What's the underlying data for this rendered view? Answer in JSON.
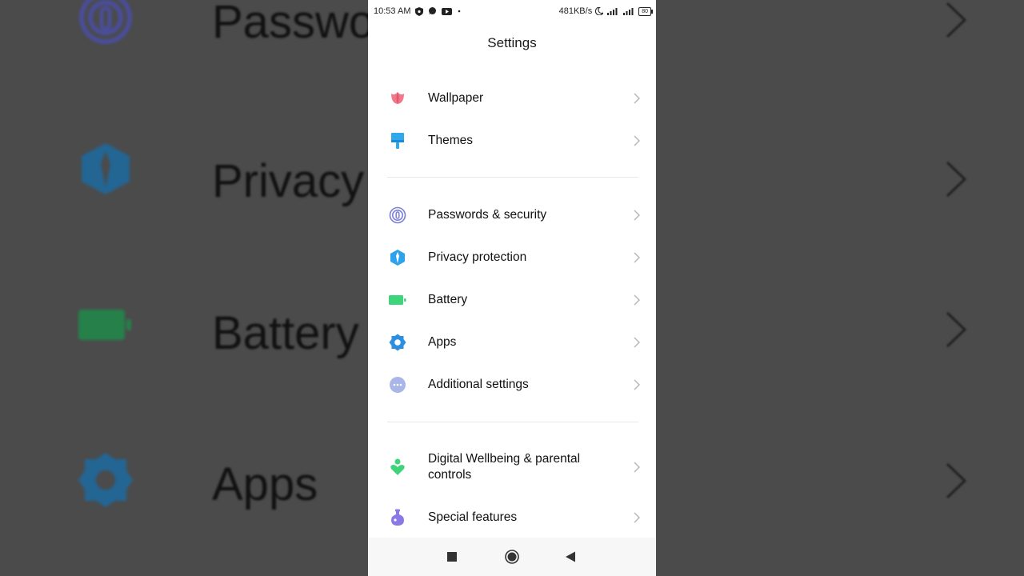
{
  "background": {
    "rows": [
      {
        "label": "Passwords & security",
        "icon": "fingerprint-icon"
      },
      {
        "label": "Privacy protection",
        "icon": "shield-icon"
      },
      {
        "label": "Battery",
        "icon": "battery-icon"
      },
      {
        "label": "Apps",
        "icon": "gear-icon"
      }
    ]
  },
  "status_bar": {
    "time": "10:53 AM",
    "speed": "481KB/s",
    "battery": "80",
    "icons_left": [
      "vpn-shield-icon",
      "chat-icon",
      "youtube-icon",
      "dot-icon"
    ],
    "icons_right": [
      "moon-icon",
      "signal-icon",
      "signal-icon",
      "battery-icon"
    ]
  },
  "header": {
    "title": "Settings"
  },
  "settings": {
    "wallpaper": "Wallpaper",
    "themes": "Themes",
    "passwords": "Passwords & security",
    "privacy": "Privacy protection",
    "battery": "Battery",
    "apps": "Apps",
    "additional": "Additional settings",
    "wellbeing": "Digital Wellbeing & parental controls",
    "special": "Special features"
  },
  "colors": {
    "wallpaper": "#f0788a",
    "themes": "#2fa8ec",
    "passwords": "#7b7fd9",
    "privacy": "#2fa2ec",
    "battery": "#3ed47a",
    "apps": "#2d8fe0",
    "additional": "#a9b6e8",
    "wellbeing": "#3ed47a",
    "special": "#8a78e6"
  },
  "navigation": {
    "recents": "square-icon",
    "home": "circle-icon",
    "back": "triangle-back-icon"
  }
}
